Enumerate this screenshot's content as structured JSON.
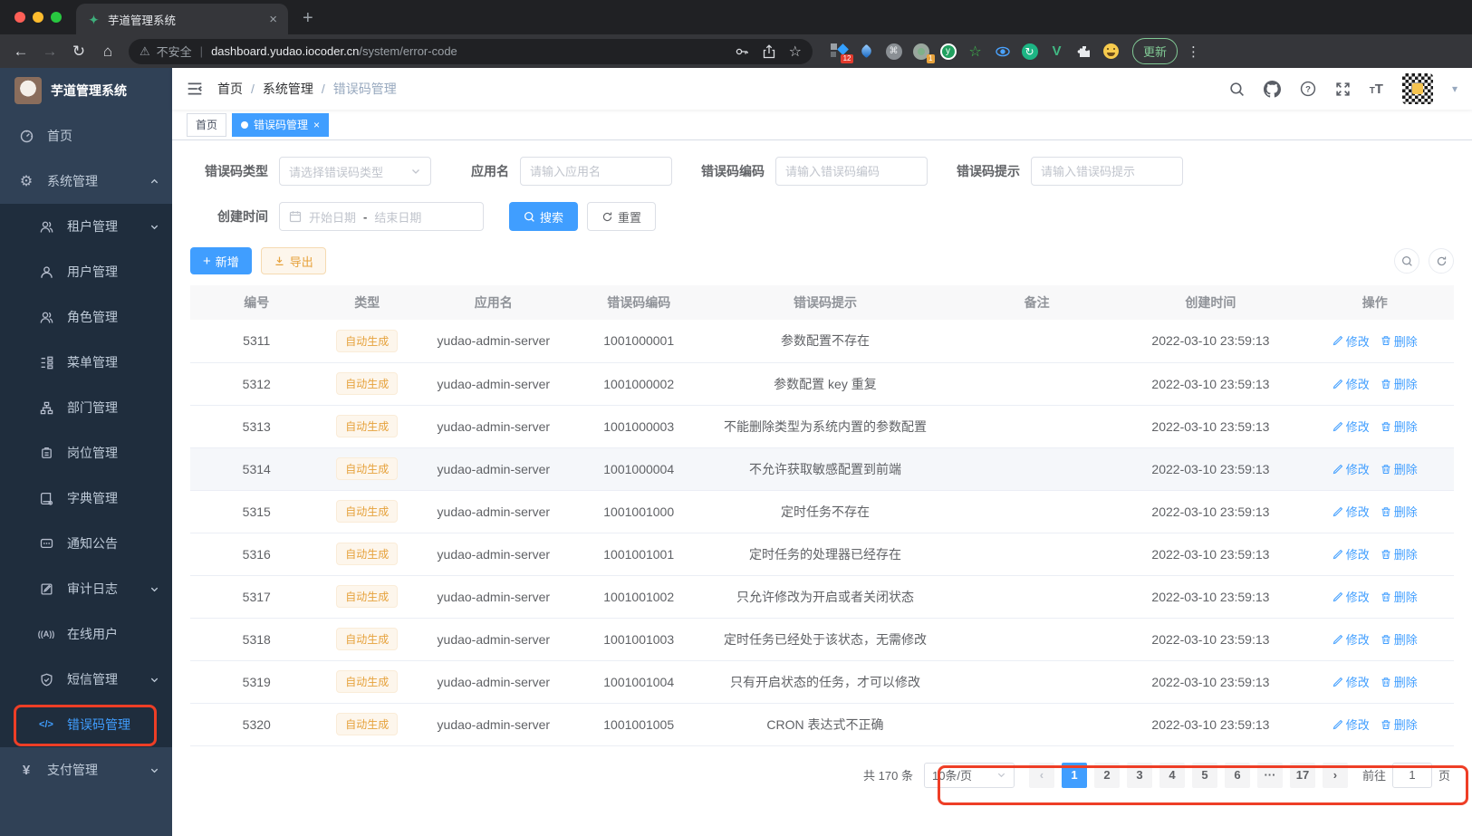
{
  "browser": {
    "tab_title": "芋道管理系统",
    "security_label": "不安全",
    "url_host": "dashboard.yudao.iocoder.cn",
    "url_path": "/system/error-code",
    "ext_badge_a": "12",
    "ext_badge_b": "1",
    "update_button": "更新"
  },
  "icons": {
    "back": "←",
    "forward": "→",
    "reload": "↻",
    "home": "⌂",
    "warning": "⚠",
    "star": "☆",
    "plus": "+",
    "close": "×",
    "caret_down": "▾",
    "menu_dots": "⋮",
    "gear": "⚙",
    "code": "</>",
    "online": "((A))",
    "pay": "¥",
    "command": "⌘",
    "y_ext": "y",
    "vue": "V",
    "star_ext": "☆",
    "refresh_ext": "↻"
  },
  "sidebar": {
    "app_title": "芋道管理系统",
    "items": [
      {
        "label": "首页"
      },
      {
        "label": "系统管理"
      },
      {
        "label": "租户管理"
      },
      {
        "label": "用户管理"
      },
      {
        "label": "角色管理"
      },
      {
        "label": "菜单管理"
      },
      {
        "label": "部门管理"
      },
      {
        "label": "岗位管理"
      },
      {
        "label": "字典管理"
      },
      {
        "label": "通知公告"
      },
      {
        "label": "审计日志"
      },
      {
        "label": "在线用户"
      },
      {
        "label": "短信管理"
      },
      {
        "label": "错误码管理"
      },
      {
        "label": "支付管理"
      }
    ]
  },
  "breadcrumb": {
    "items": [
      "首页",
      "系统管理",
      "错误码管理"
    ],
    "separator": "/"
  },
  "tags": {
    "home": "首页",
    "active": "错误码管理"
  },
  "filters": {
    "type_label": "错误码类型",
    "type_placeholder": "请选择错误码类型",
    "app_label": "应用名",
    "app_placeholder": "请输入应用名",
    "code_label": "错误码编码",
    "code_placeholder": "请输入错误码编码",
    "msg_label": "错误码提示",
    "msg_placeholder": "请输入错误码提示",
    "time_label": "创建时间",
    "start_placeholder": "开始日期",
    "range_separator": "-",
    "end_placeholder": "结束日期",
    "search_button": "搜索",
    "reset_button": "重置"
  },
  "toolbar": {
    "add_button": "新增",
    "export_button": "导出"
  },
  "table": {
    "columns": [
      "编号",
      "类型",
      "应用名",
      "错误码编码",
      "错误码提示",
      "备注",
      "创建时间",
      "操作"
    ],
    "edit_label": "修改",
    "delete_label": "删除",
    "rows": [
      {
        "id": "5311",
        "type": "自动生成",
        "app": "yudao-admin-server",
        "code": "1001000001",
        "msg": "参数配置不存在",
        "remark": "",
        "created": "2022-03-10 23:59:13"
      },
      {
        "id": "5312",
        "type": "自动生成",
        "app": "yudao-admin-server",
        "code": "1001000002",
        "msg": "参数配置 key 重复",
        "remark": "",
        "created": "2022-03-10 23:59:13"
      },
      {
        "id": "5313",
        "type": "自动生成",
        "app": "yudao-admin-server",
        "code": "1001000003",
        "msg": "不能删除类型为系统内置的参数配置",
        "remark": "",
        "created": "2022-03-10 23:59:13"
      },
      {
        "id": "5314",
        "type": "自动生成",
        "app": "yudao-admin-server",
        "code": "1001000004",
        "msg": "不允许获取敏感配置到前端",
        "remark": "",
        "created": "2022-03-10 23:59:13"
      },
      {
        "id": "5315",
        "type": "自动生成",
        "app": "yudao-admin-server",
        "code": "1001001000",
        "msg": "定时任务不存在",
        "remark": "",
        "created": "2022-03-10 23:59:13"
      },
      {
        "id": "5316",
        "type": "自动生成",
        "app": "yudao-admin-server",
        "code": "1001001001",
        "msg": "定时任务的处理器已经存在",
        "remark": "",
        "created": "2022-03-10 23:59:13"
      },
      {
        "id": "5317",
        "type": "自动生成",
        "app": "yudao-admin-server",
        "code": "1001001002",
        "msg": "只允许修改为开启或者关闭状态",
        "remark": "",
        "created": "2022-03-10 23:59:13"
      },
      {
        "id": "5318",
        "type": "自动生成",
        "app": "yudao-admin-server",
        "code": "1001001003",
        "msg": "定时任务已经处于该状态，无需修改",
        "remark": "",
        "created": "2022-03-10 23:59:13"
      },
      {
        "id": "5319",
        "type": "自动生成",
        "app": "yudao-admin-server",
        "code": "1001001004",
        "msg": "只有开启状态的任务，才可以修改",
        "remark": "",
        "created": "2022-03-10 23:59:13"
      },
      {
        "id": "5320",
        "type": "自动生成",
        "app": "yudao-admin-server",
        "code": "1001001005",
        "msg": "CRON 表达式不正确",
        "remark": "",
        "created": "2022-03-10 23:59:13"
      }
    ]
  },
  "pagination": {
    "total": "共 170 条",
    "page_size": "10条/页",
    "prev": "‹",
    "next": "›",
    "pages": [
      "1",
      "2",
      "3",
      "4",
      "5",
      "6",
      "···",
      "17"
    ],
    "goto_label": "前往",
    "goto_value": "1",
    "page_unit": "页"
  },
  "colors": {
    "accent": "#409eff",
    "warning": "#e6a23c",
    "sidebar_bg": "#304156",
    "submenu_bg": "#1f2d3d",
    "annotation": "#ee3e26"
  }
}
